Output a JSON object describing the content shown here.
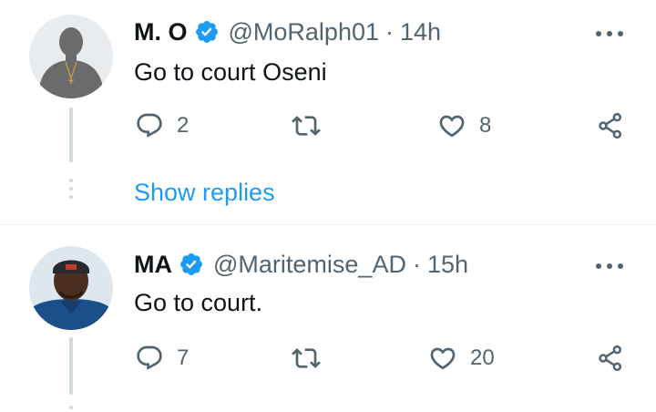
{
  "tweets": [
    {
      "name": "M. O",
      "handle": "@MoRalph01",
      "separator": "·",
      "time": "14h",
      "text": "Go to court Oseni",
      "replies": "2",
      "retweets": "",
      "likes": "8",
      "show_replies": "Show replies",
      "avatar": "default-silhouette"
    },
    {
      "name": "MA",
      "handle": "@Maritemise_AD",
      "separator": "·",
      "time": "15h",
      "text": "Go to court.",
      "replies": "7",
      "retweets": "",
      "likes": "20",
      "avatar": "profile-photo"
    }
  ],
  "colors": {
    "verified": "#1d9bf0",
    "link": "#1d9bf0",
    "secondary_text": "#536471",
    "thread_line": "#cfd9de"
  },
  "icons": [
    "verified-badge-icon",
    "more-icon",
    "reply-icon",
    "retweet-icon",
    "like-icon",
    "share-icon"
  ]
}
